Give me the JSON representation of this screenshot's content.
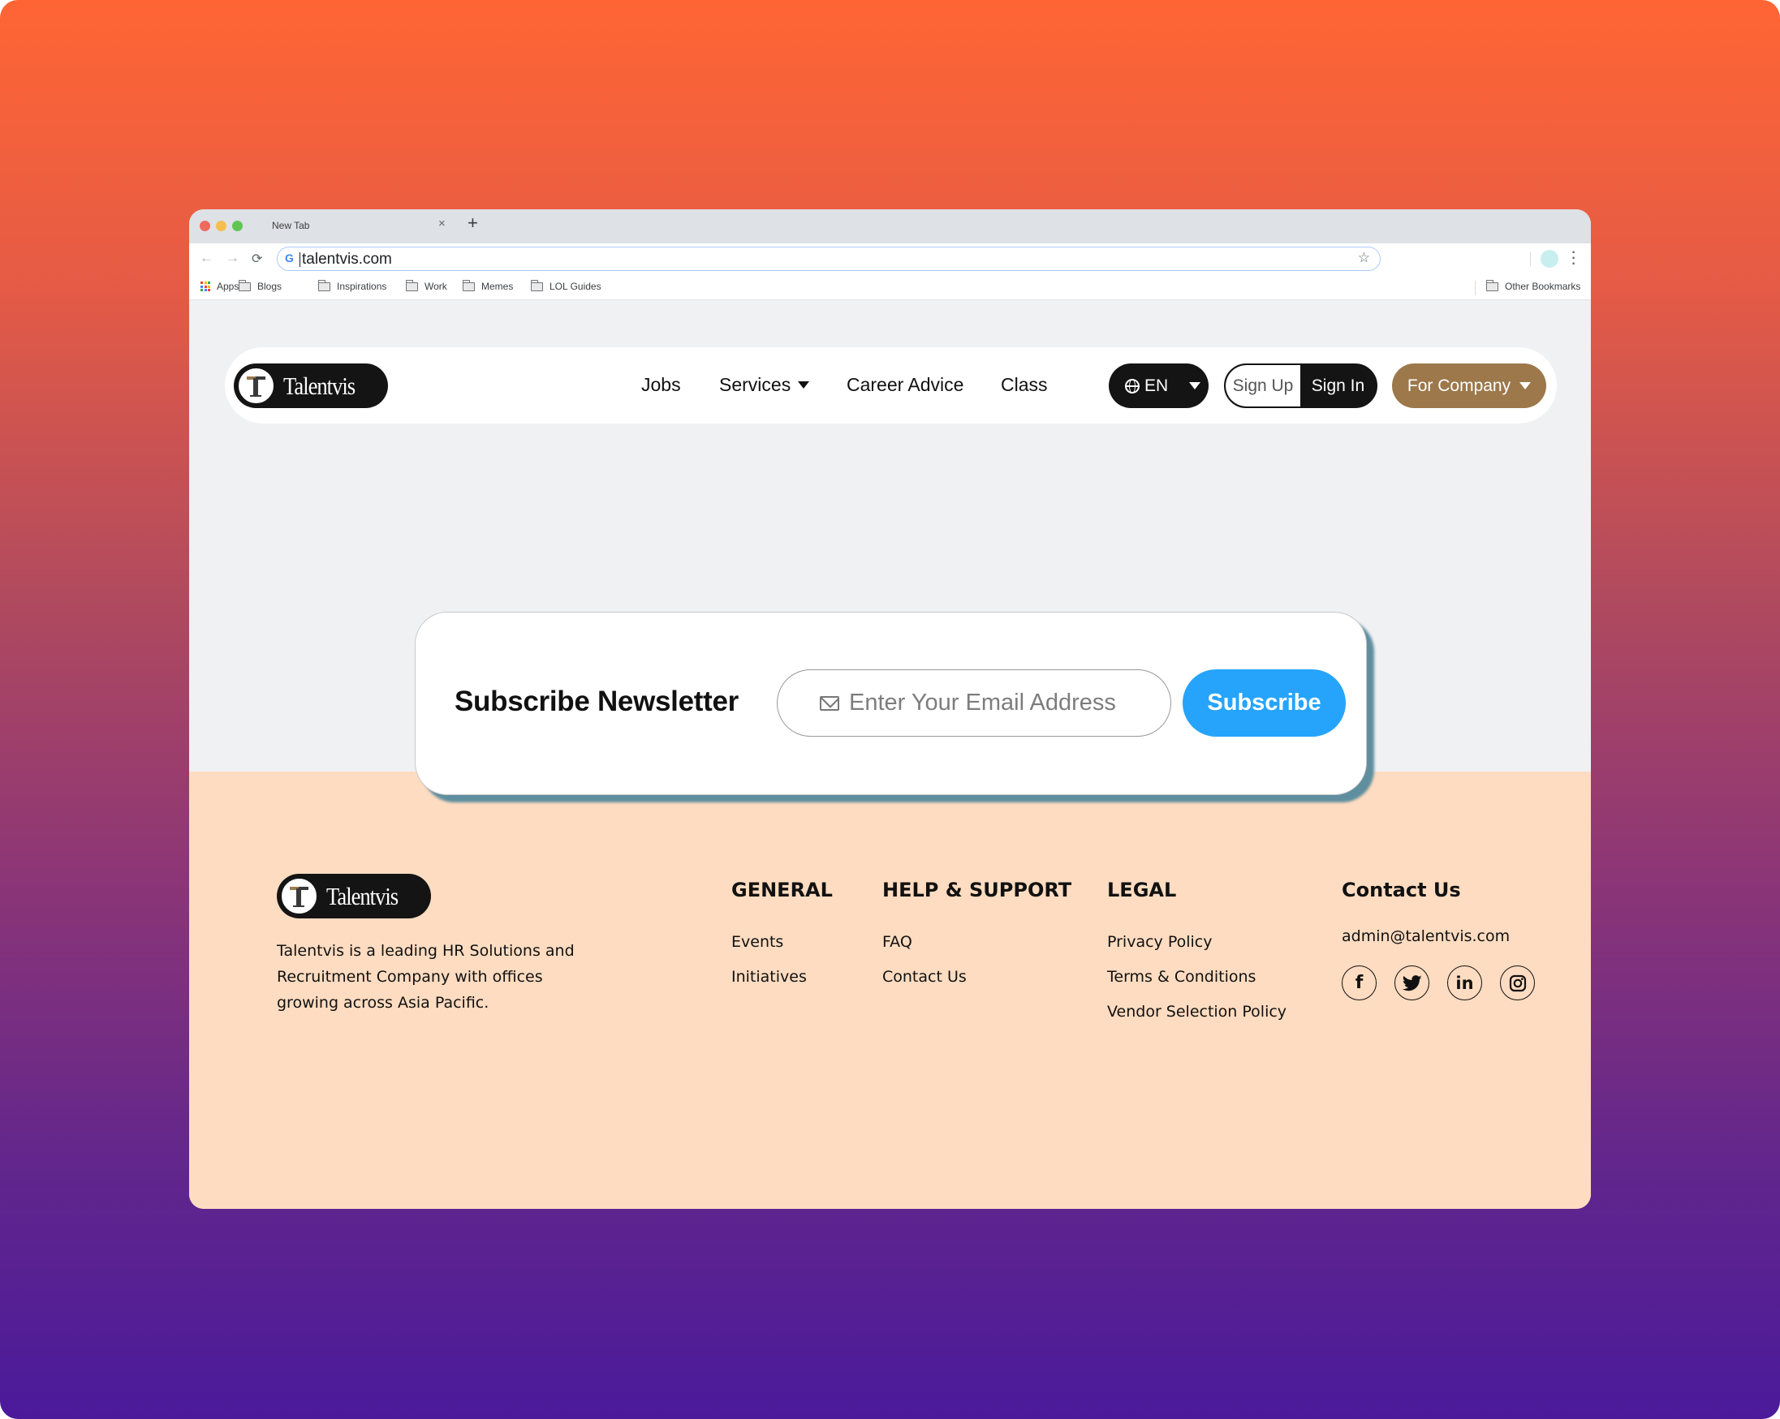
{
  "browser": {
    "tab_title": "New Tab",
    "tab_close": "×",
    "new_tab": "+",
    "url": "talentvis.com",
    "back": "←",
    "forward": "→",
    "reload": "⟳",
    "star": "☆",
    "google_g": "G",
    "bookmarks": [
      {
        "label": "Apps",
        "icon": "apps-grid-icon"
      },
      {
        "label": "Blogs",
        "icon": "folder-icon"
      },
      {
        "label": "Inspirations",
        "icon": "folder-icon"
      },
      {
        "label": "Work",
        "icon": "folder-icon"
      },
      {
        "label": "Memes",
        "icon": "folder-icon"
      },
      {
        "label": "LOL Guides",
        "icon": "folder-icon"
      }
    ],
    "other_bookmarks": "Other Bookmarks"
  },
  "site": {
    "brand": "Talentvis",
    "logo_letter": "T",
    "nav": {
      "links": [
        "Jobs",
        "Services",
        "Career Advice",
        "Class"
      ],
      "language": "EN",
      "sign_up": "Sign Up",
      "sign_in": "Sign In",
      "for_company": "For Company"
    },
    "newsletter": {
      "title": "Subscribe Newsletter",
      "email_placeholder": "Enter Your Email Address",
      "email_value": "",
      "button": "Subscribe"
    },
    "footer": {
      "description": "Talentvis is a leading HR Solutions and Recruitment Company with offices growing across Asia Pacific.",
      "columns": [
        {
          "heading": "GENERAL",
          "links": [
            "Events",
            "Initiatives"
          ]
        },
        {
          "heading": "HELP & SUPPORT",
          "links": [
            "FAQ",
            "Contact Us"
          ]
        },
        {
          "heading": "LEGAL",
          "links": [
            "Privacy Policy",
            "Terms & Conditions",
            "Vendor Selection Policy"
          ]
        }
      ],
      "contact": {
        "heading": "Contact Us",
        "email": "admin@talentvis.com",
        "social": [
          {
            "name": "facebook",
            "glyph": "f"
          },
          {
            "name": "twitter",
            "glyph": "🐦"
          },
          {
            "name": "linkedin",
            "glyph": "in"
          },
          {
            "name": "instagram",
            "glyph": "◎"
          }
        ]
      }
    }
  },
  "colors": {
    "brand_dark": "#141414",
    "brand_gold": "#9c784b",
    "subscribe_blue": "#26a4fb",
    "footer_peach": "#fedcc1",
    "card_shadow": "#5f8e9f",
    "page_bg": "#f0f1f3"
  }
}
